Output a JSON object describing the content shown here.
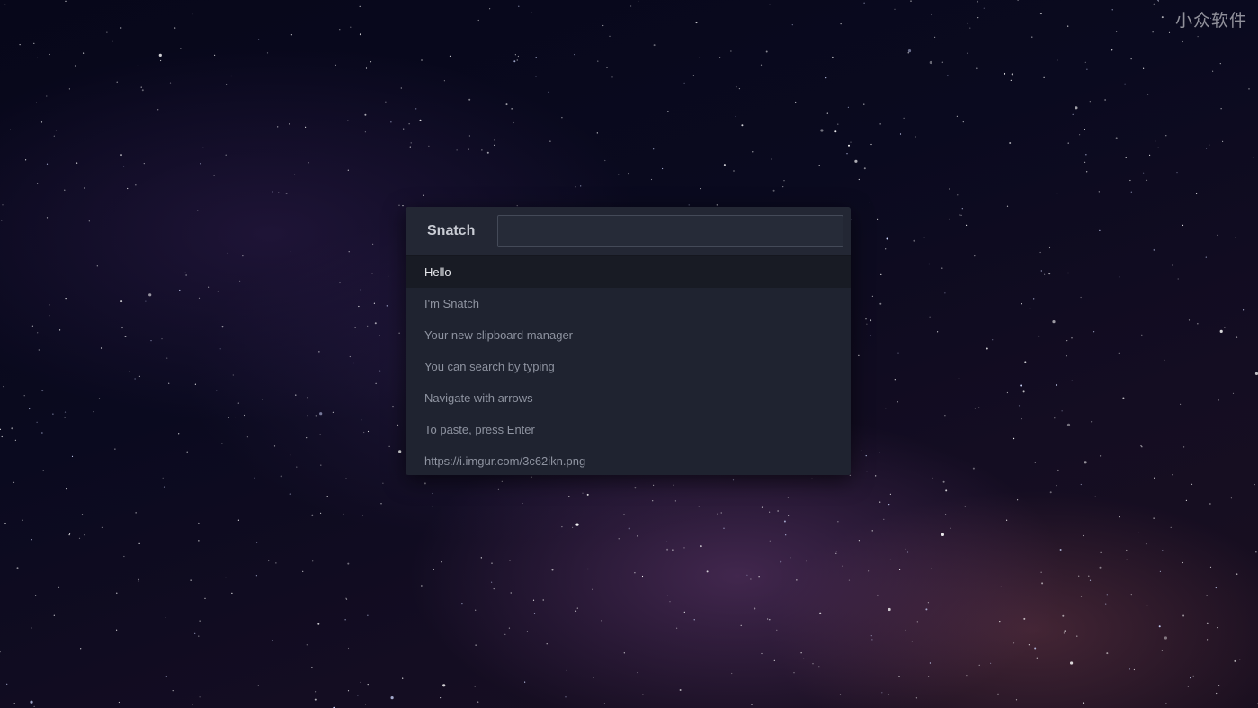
{
  "watermark": "小众软件",
  "app": {
    "title": "Snatch",
    "search": {
      "value": "",
      "placeholder": ""
    },
    "selected_index": 0,
    "items": [
      {
        "label": "Hello"
      },
      {
        "label": "I'm Snatch"
      },
      {
        "label": "Your new clipboard manager"
      },
      {
        "label": "You can search by typing"
      },
      {
        "label": "Navigate with arrows"
      },
      {
        "label": "To paste, press Enter"
      },
      {
        "label": "https://i.imgur.com/3c62ikn.png"
      }
    ]
  }
}
